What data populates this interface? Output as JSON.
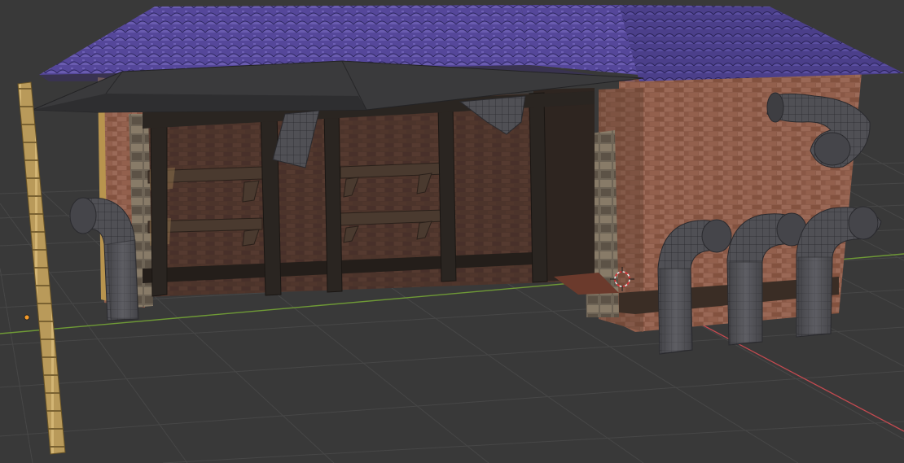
{
  "viewport": {
    "view_mode": "solid-textured",
    "shading": "viewport"
  },
  "colors": {
    "background": "#393939",
    "grid_line": "#464646",
    "x_axis": "#c94a50",
    "y_axis": "#7da33a",
    "roof_tiles": "#5a4c9a",
    "canopy": "#3a3a3c",
    "brick": "#8a5a48",
    "beam": "#2b2622",
    "pipe": "#4c4c50",
    "pole": "#b89a58",
    "origin_dot": "#f39a2a",
    "cursor_red": "#e0333a"
  },
  "icons": {
    "cursor": "3d-cursor-icon",
    "origin": "object-origin-icon"
  }
}
